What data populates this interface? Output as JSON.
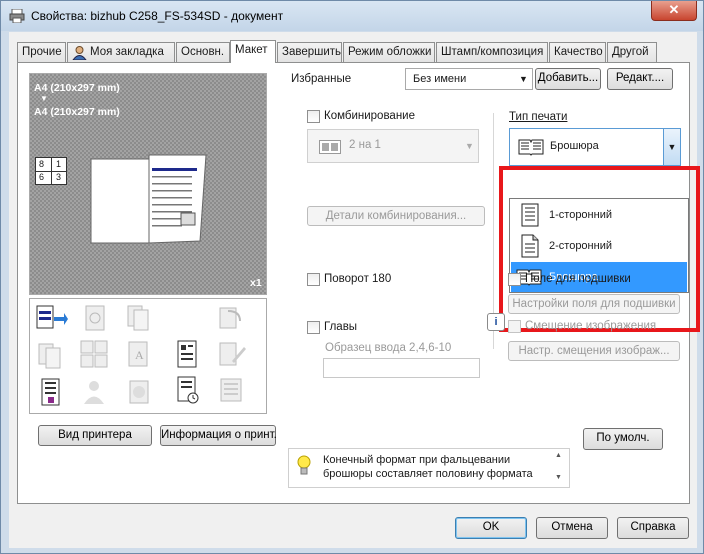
{
  "window": {
    "title": "Свойства: bizhub C258_FS-534SD - документ",
    "close_label": "✕"
  },
  "tabs": [
    {
      "label": "Прочие"
    },
    {
      "label": "Моя закладка"
    },
    {
      "label": "Основн."
    },
    {
      "label": "Макет"
    },
    {
      "label": "Завершить"
    },
    {
      "label": "Режим обложки"
    },
    {
      "label": "Штамп/композиция"
    },
    {
      "label": "Качество"
    },
    {
      "label": "Другой"
    }
  ],
  "preview": {
    "paper_top": "A4 (210x297 mm)",
    "arrow": "▼",
    "paper_bottom": "A4 (210x297 mm)",
    "copies": "x1",
    "page_left": "8",
    "page_right": "1",
    "page_bl": "6",
    "page_br": "3"
  },
  "favorites": {
    "label": "Избранные",
    "value": "Без имени",
    "add_button": "Добавить...",
    "edit_button": "Редакт...."
  },
  "combine": {
    "label": "Комбинирование",
    "value": "2 на 1",
    "details_button": "Детали комбинирования..."
  },
  "print_type": {
    "label": "Тип печати",
    "value": "Брошюра",
    "options": [
      "1-сторонний",
      "2-сторонний",
      "Брошюра"
    ]
  },
  "rotate": {
    "label": "Поворот 180"
  },
  "chapters": {
    "label": "Главы",
    "placeholder": "Образец ввода 2,4,6-10"
  },
  "binding": {
    "label": "Поле для подшивки",
    "settings_button": "Настройки поля для подшивки"
  },
  "shift": {
    "label": "Смещение изображения",
    "settings_button": "Настр. смещения изображ..."
  },
  "left_buttons": {
    "printer_view": "Вид принтера",
    "printer_info": "Информация о принт."
  },
  "hint": {
    "line1": "Конечный формат при фальцевании",
    "line2": "брошюры составляет половину формата"
  },
  "defaults_button": "По умолч.",
  "footer": {
    "ok": "OK",
    "cancel": "Отмена",
    "help": "Справка"
  }
}
